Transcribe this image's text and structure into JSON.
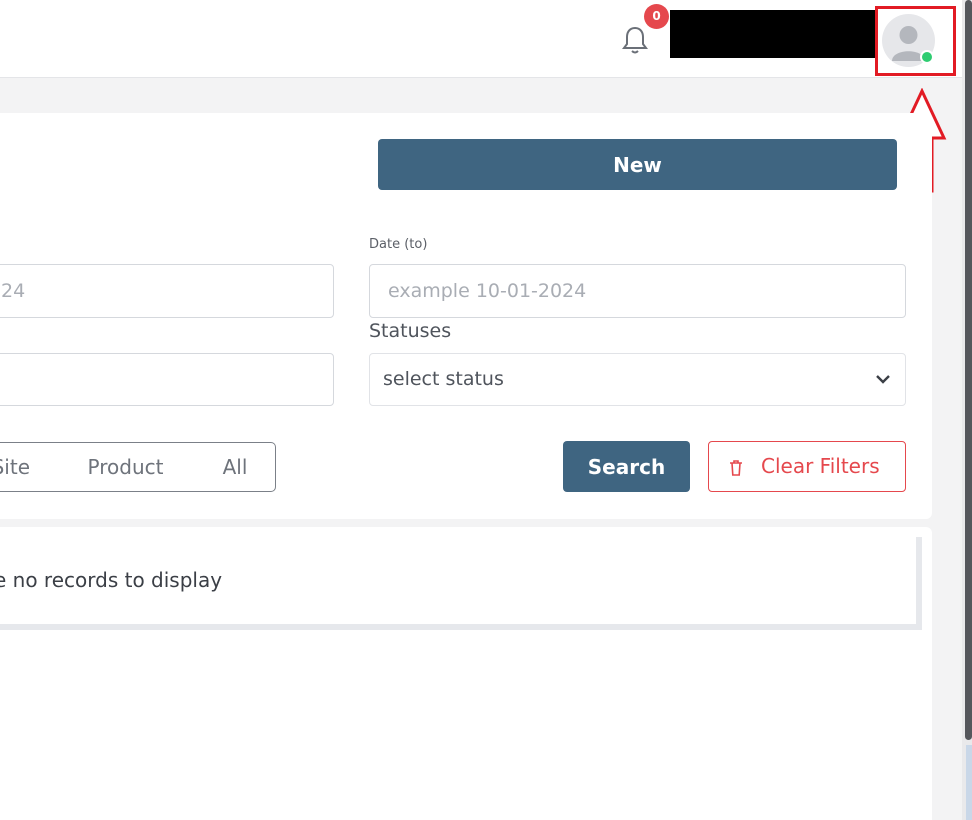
{
  "header": {
    "notification_count": "0",
    "bell_icon": "bell-icon",
    "avatar_icon": "user-avatar-icon",
    "status_color": "#2ecc71"
  },
  "toolbar": {
    "new_label": "New"
  },
  "filters": {
    "date_from_placeholder": "24",
    "date_to_label": "Date (to)",
    "date_to_placeholder": "example 10-01-2024",
    "statuses_label": "Statuses",
    "status_select_value": "select status",
    "segments": [
      "Site",
      "Product",
      "All"
    ],
    "search_label": "Search",
    "clear_label": "Clear Filters"
  },
  "results": {
    "empty_message": "e no records to display"
  },
  "colors": {
    "primary": "#3f6581",
    "danger": "#e5484d",
    "highlight": "#e21b24"
  }
}
